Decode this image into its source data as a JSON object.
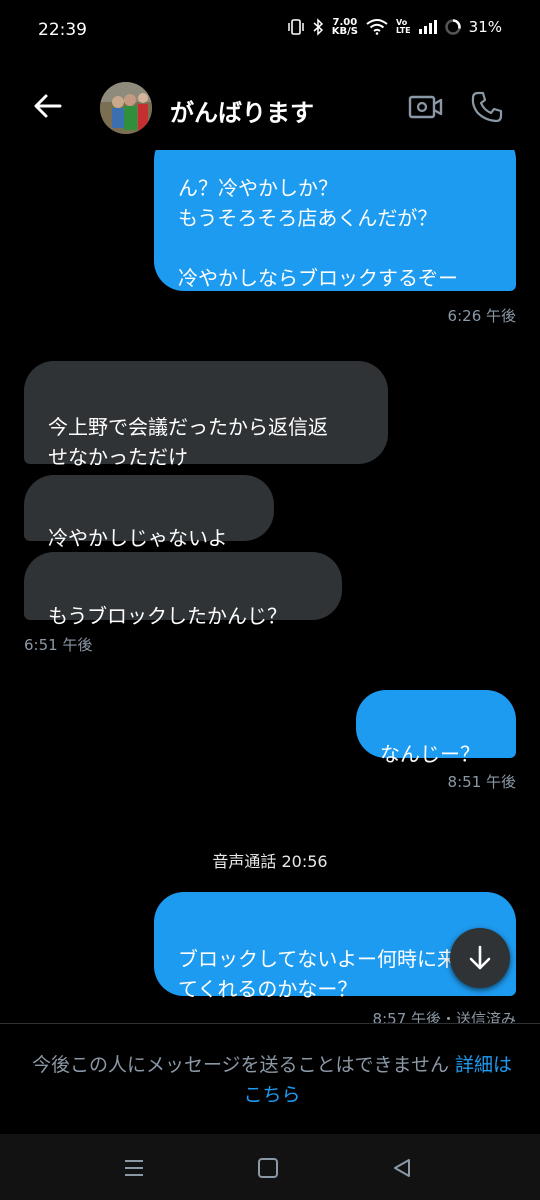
{
  "status_bar": {
    "time": "22:39",
    "speed_value": "7.00",
    "speed_unit": "KB/S",
    "volte_top": "Vo",
    "volte_bottom": "LTE",
    "battery": "31%"
  },
  "header": {
    "title": "がんばります",
    "icons": [
      "back-arrow-icon",
      "video-call-icon",
      "phone-call-icon"
    ]
  },
  "messages": [
    {
      "type": "sent",
      "text": "ん？冷やかしか？\nもうそろそろ店あくんだが？\n\n冷やかしならブロックするぞー",
      "time": "6:26 午後"
    },
    {
      "type": "received",
      "text": "今上野で会議だったから返信返\nせなかっただけ"
    },
    {
      "type": "received",
      "text": "冷やかしじゃないよ"
    },
    {
      "type": "received",
      "text": "もうブロックしたかんじ？",
      "time": "6:51 午後"
    },
    {
      "type": "sent",
      "text": "なんじー？",
      "time": "8:51 午後"
    },
    {
      "type": "call",
      "text": "音声通話 20:56"
    },
    {
      "type": "sent",
      "text": "ブロックしてないよー何時に来\nてくれるのかなー？",
      "time": "8:57 午後・送信済み"
    }
  ],
  "notice": {
    "text": "今後この人にメッセージを送ることはできません ",
    "link": "詳細はこちら"
  },
  "colors": {
    "accent": "#1d9bf0",
    "received_bubble": "#2f3336",
    "background": "#000000",
    "muted_text": "#8b98a5"
  }
}
